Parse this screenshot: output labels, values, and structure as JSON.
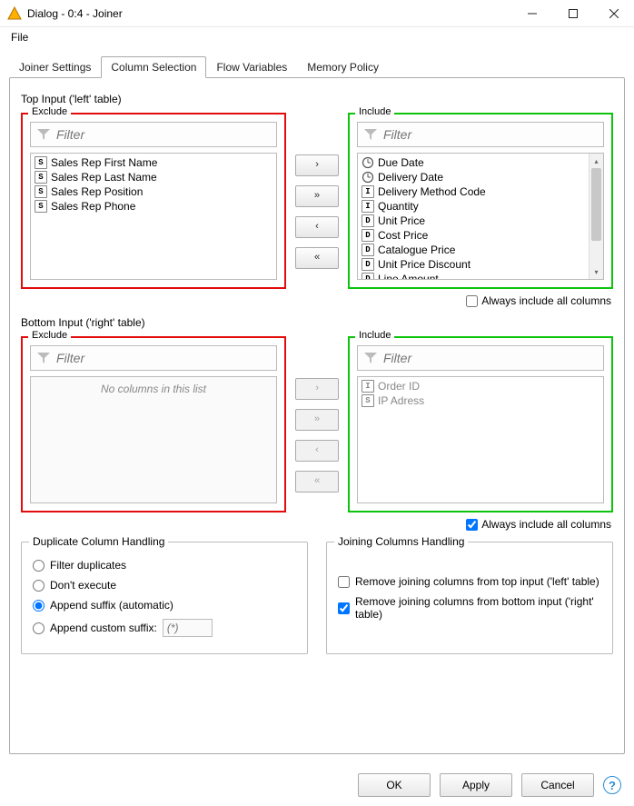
{
  "window": {
    "title": "Dialog - 0:4 - Joiner"
  },
  "menus": {
    "file": "File"
  },
  "tabs": {
    "joiner": "Joiner Settings",
    "column": "Column Selection",
    "flow": "Flow Variables",
    "memory": "Memory Policy"
  },
  "top": {
    "title": "Top Input ('left' table)",
    "exclude": {
      "legend": "Exclude",
      "filter_placeholder": "Filter",
      "items": [
        {
          "type": "S",
          "label": "Sales Rep First Name"
        },
        {
          "type": "S",
          "label": "Sales Rep Last Name"
        },
        {
          "type": "S",
          "label": "Sales Rep Position"
        },
        {
          "type": "S",
          "label": "Sales Rep Phone"
        }
      ]
    },
    "include": {
      "legend": "Include",
      "filter_placeholder": "Filter",
      "items": [
        {
          "type": "date",
          "label": "Due Date"
        },
        {
          "type": "date",
          "label": "Delivery Date"
        },
        {
          "type": "I",
          "label": "Delivery Method Code"
        },
        {
          "type": "I",
          "label": "Quantity"
        },
        {
          "type": "D",
          "label": "Unit Price"
        },
        {
          "type": "D",
          "label": "Cost Price"
        },
        {
          "type": "D",
          "label": "Catalogue Price"
        },
        {
          "type": "D",
          "label": "Unit Price Discount"
        },
        {
          "type": "D",
          "label": "Line Amount"
        }
      ]
    },
    "always": "Always include all columns"
  },
  "bottom": {
    "title": "Bottom Input ('right' table)",
    "exclude": {
      "legend": "Exclude",
      "filter_placeholder": "Filter",
      "empty": "No columns in this list"
    },
    "include": {
      "legend": "Include",
      "filter_placeholder": "Filter",
      "items": [
        {
          "type": "I",
          "label": "Order ID"
        },
        {
          "type": "S",
          "label": "IP Adress"
        }
      ]
    },
    "always": "Always include all columns"
  },
  "duplicate": {
    "legend": "Duplicate Column Handling",
    "filter_dup": "Filter duplicates",
    "dont_exec": "Don't execute",
    "append_auto": "Append suffix (automatic)",
    "append_custom": "Append custom suffix:",
    "suffix_placeholder": "(*)"
  },
  "joining": {
    "legend": "Joining Columns Handling",
    "remove_top": "Remove joining columns from top input ('left' table)",
    "remove_bottom": "Remove joining columns from bottom input ('right' table)"
  },
  "buttons": {
    "ok": "OK",
    "apply": "Apply",
    "cancel": "Cancel"
  }
}
